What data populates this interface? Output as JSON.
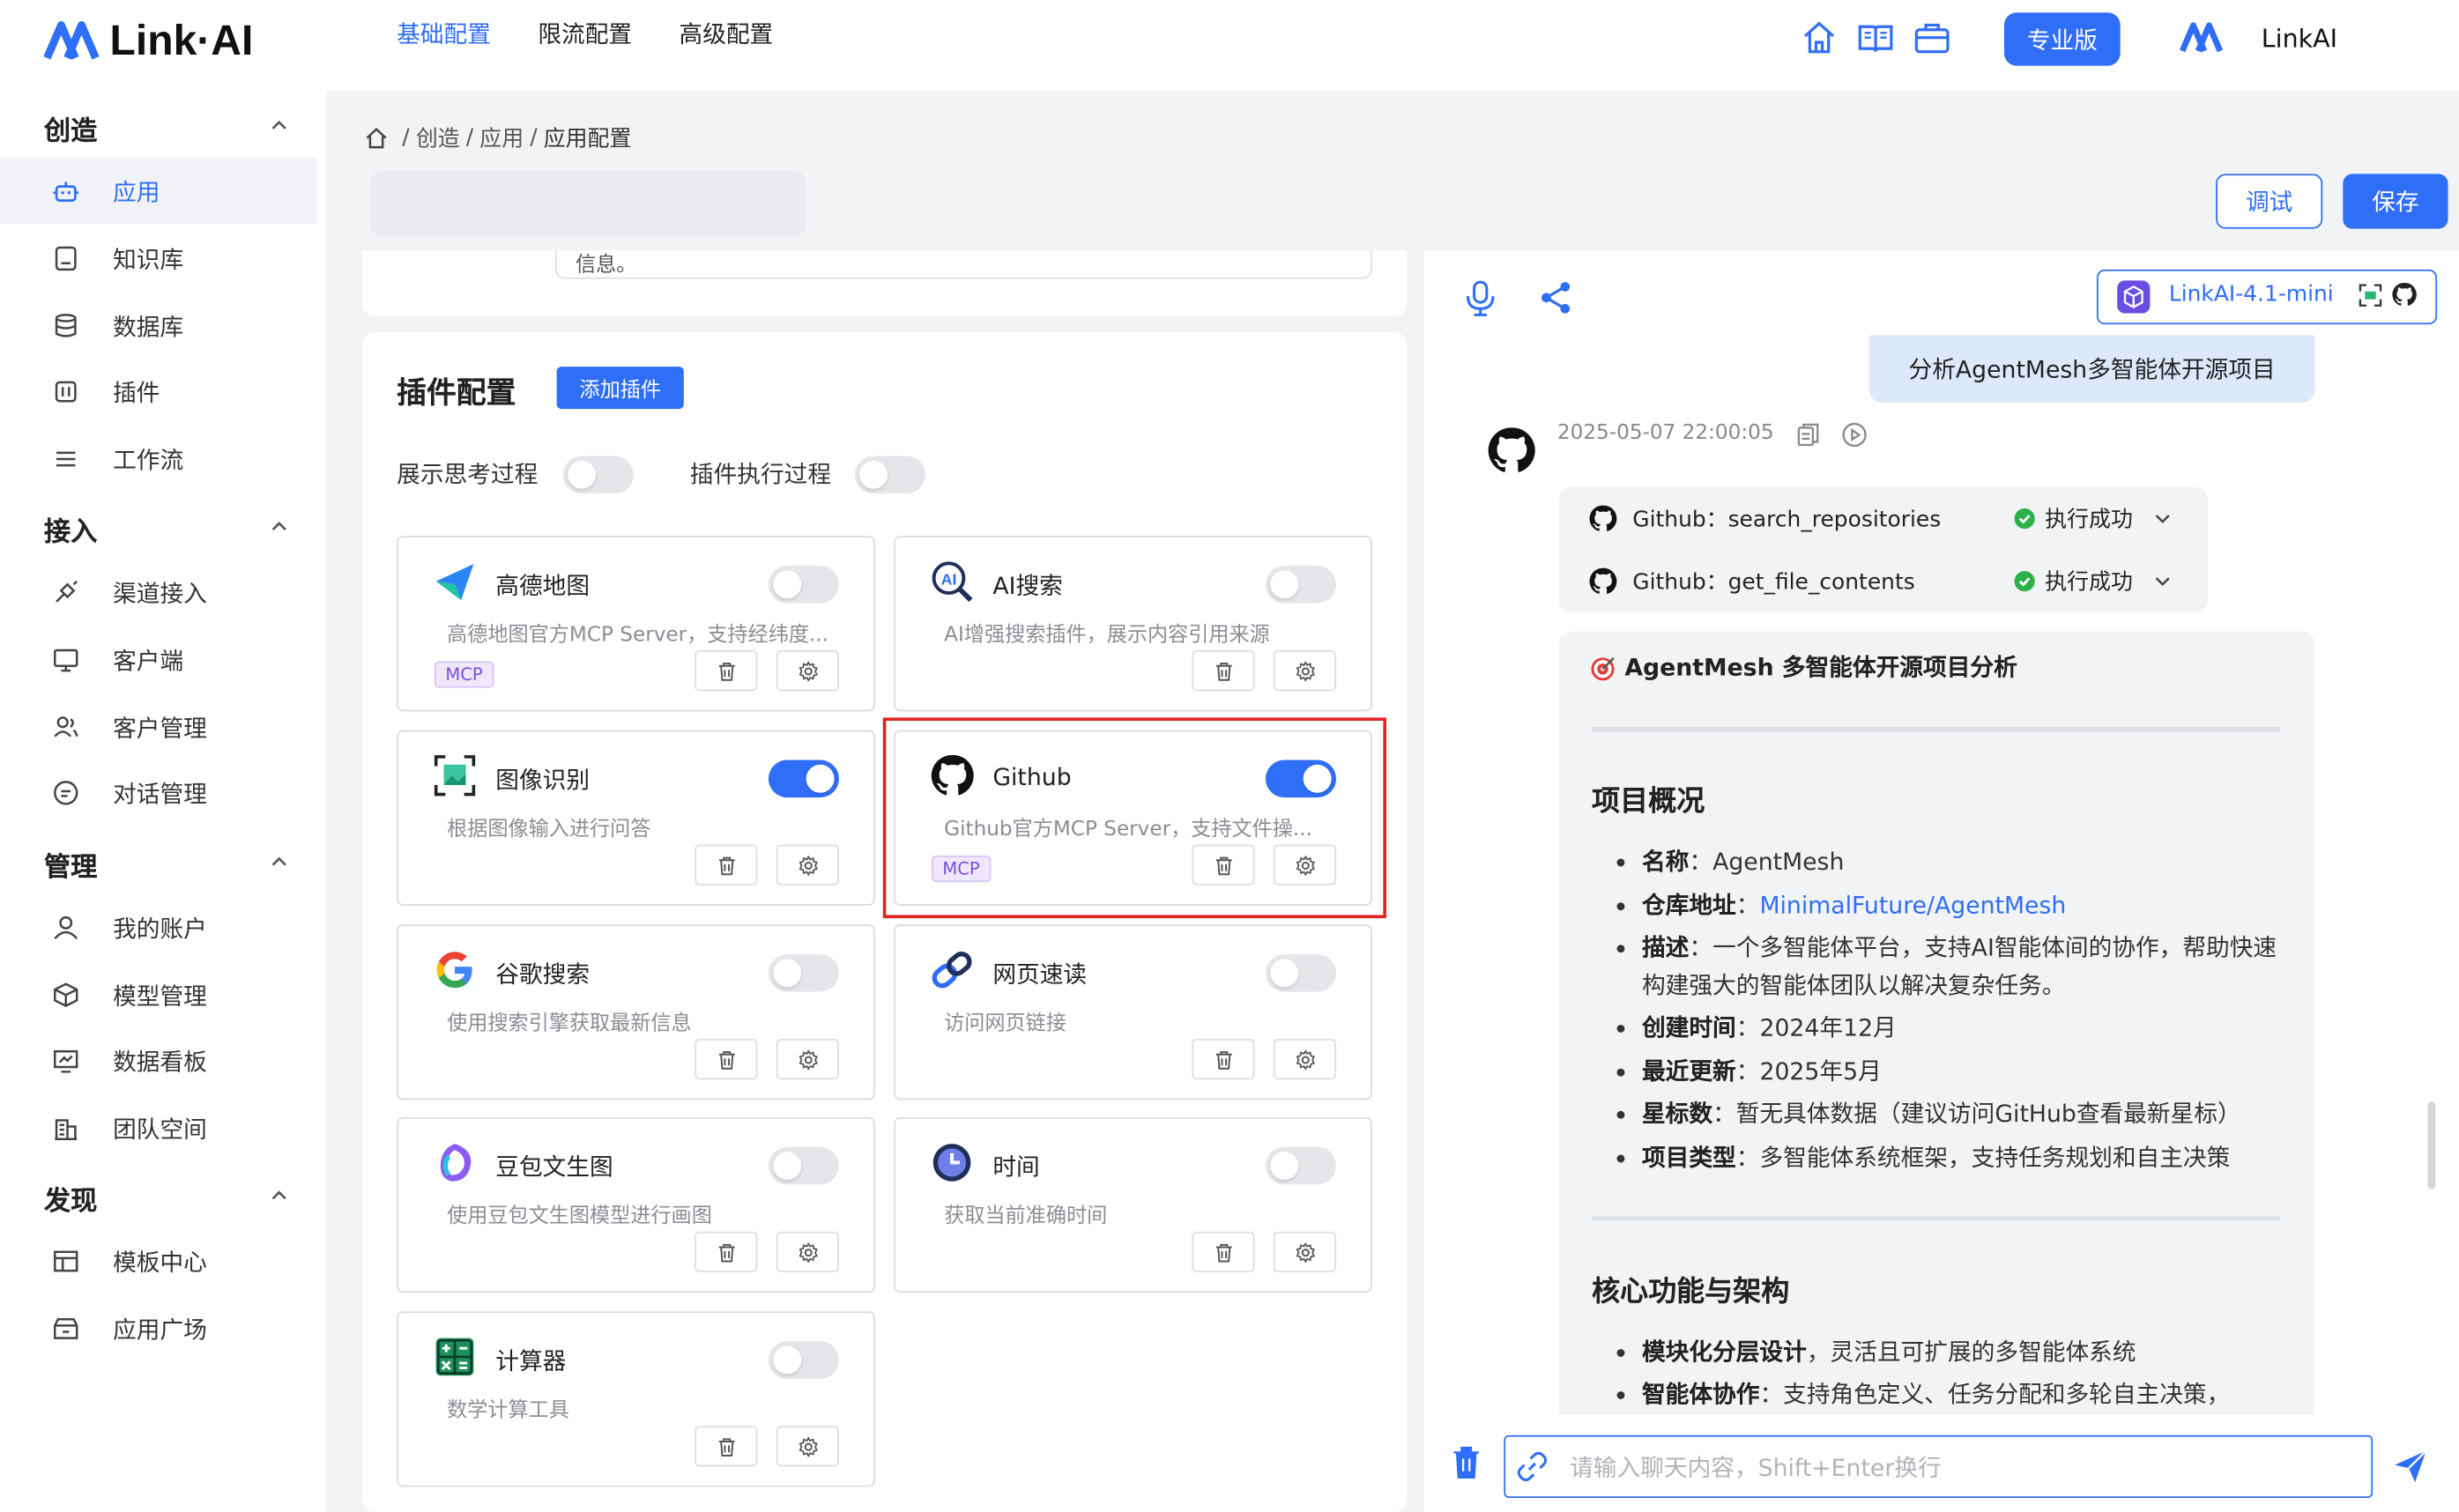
{
  "header": {
    "logo_text": "Link·AI",
    "nav_icons": [
      "home-icon",
      "book-icon",
      "briefcase-icon"
    ],
    "pro_label": "专业版",
    "username": "LinkAI"
  },
  "sidebar": {
    "sections": [
      {
        "title": "创造",
        "items": [
          "应用",
          "知识库",
          "数据库",
          "插件",
          "工作流"
        ]
      },
      {
        "title": "接入",
        "items": [
          "渠道接入",
          "客户端",
          "客户管理",
          "对话管理"
        ]
      },
      {
        "title": "管理",
        "items": [
          "我的账户",
          "模型管理",
          "数据看板",
          "团队空间"
        ]
      },
      {
        "title": "发现",
        "items": [
          "模板中心",
          "应用广场"
        ]
      }
    ],
    "active_item": "应用"
  },
  "breadcrumb": [
    "创造",
    "应用",
    "应用配置"
  ],
  "tabs": [
    "基础配置",
    "限流配置",
    "高级配置"
  ],
  "actions": {
    "debug": "调试",
    "save": "保存"
  },
  "prev_field_stub": "信息。",
  "plugins": {
    "title": "插件配置",
    "add_button": "添加插件",
    "options": [
      {
        "label": "展示思考过程",
        "enabled": false
      },
      {
        "label": "插件执行过程",
        "enabled": false
      }
    ],
    "cards": [
      {
        "name": "高德地图",
        "desc": "高德地图官方MCP Server，支持经纬度...",
        "tag": "MCP",
        "enabled": false,
        "icon": "amap-icon"
      },
      {
        "name": "AI搜索",
        "desc": "AI增强搜索插件，展示内容引用来源",
        "tag": "",
        "enabled": false,
        "icon": "ai-search-icon"
      },
      {
        "name": "图像识别",
        "desc": "根据图像输入进行问答",
        "tag": "",
        "enabled": true,
        "icon": "image-recognition-icon"
      },
      {
        "name": "Github",
        "desc": "Github官方MCP Server，支持文件操...",
        "tag": "MCP",
        "enabled": true,
        "icon": "github-icon"
      },
      {
        "name": "谷歌搜索",
        "desc": "使用搜索引擎获取最新信息",
        "tag": "",
        "enabled": false,
        "icon": "google-icon"
      },
      {
        "name": "网页速读",
        "desc": "访问网页链接",
        "tag": "",
        "enabled": false,
        "icon": "link-icon"
      },
      {
        "name": "豆包文生图",
        "desc": "使用豆包文生图模型进行画图",
        "tag": "",
        "enabled": false,
        "icon": "doubao-icon"
      },
      {
        "name": "时间",
        "desc": "获取当前准确时间",
        "tag": "",
        "enabled": false,
        "icon": "clock-icon"
      },
      {
        "name": "计算器",
        "desc": "数学计算工具",
        "tag": "",
        "enabled": false,
        "icon": "calculator-icon"
      }
    ],
    "highlighted": "Github"
  },
  "chat": {
    "model": "LinkAI-4.1-mini",
    "user_message": "分析AgentMesh多智能体开源项目",
    "timestamp": "2025-05-07 22:00:05",
    "tool_calls": [
      {
        "name": "Github：search_repositories",
        "status": "执行成功"
      },
      {
        "name": "Github：get_file_contents",
        "status": "执行成功"
      }
    ],
    "response": {
      "title": "AgentMesh 多智能体开源项目分析",
      "section1": "项目概况",
      "overview": [
        {
          "key": "名称",
          "value": "AgentMesh"
        },
        {
          "key": "仓库地址",
          "value": "MinimalFuture/AgentMesh"
        },
        {
          "key": "描述",
          "value": "一个多智能体平台，支持AI智能体间的协作，帮助快速构建强大的智能体团队以解决复杂任务。"
        },
        {
          "key": "创建时间",
          "value": "2024年12月"
        },
        {
          "key": "最近更新",
          "value": "2025年5月"
        },
        {
          "key": "星标数",
          "value": "暂无具体数据（建议访问GitHub查看最新星标）"
        },
        {
          "key": "项目类型",
          "value": "多智能体系统框架，支持任务规划和自主决策"
        }
      ],
      "section2": "核心功能与架构",
      "features": [
        {
          "key": "模块化分层设计",
          "value": "灵活且可扩展的多智能体系统"
        },
        {
          "key": "智能体协作",
          "value": "支持角色定义、任务分配和多轮自主决策，"
        }
      ]
    },
    "input_placeholder": "请输入聊天内容，Shift+Enter换行"
  }
}
